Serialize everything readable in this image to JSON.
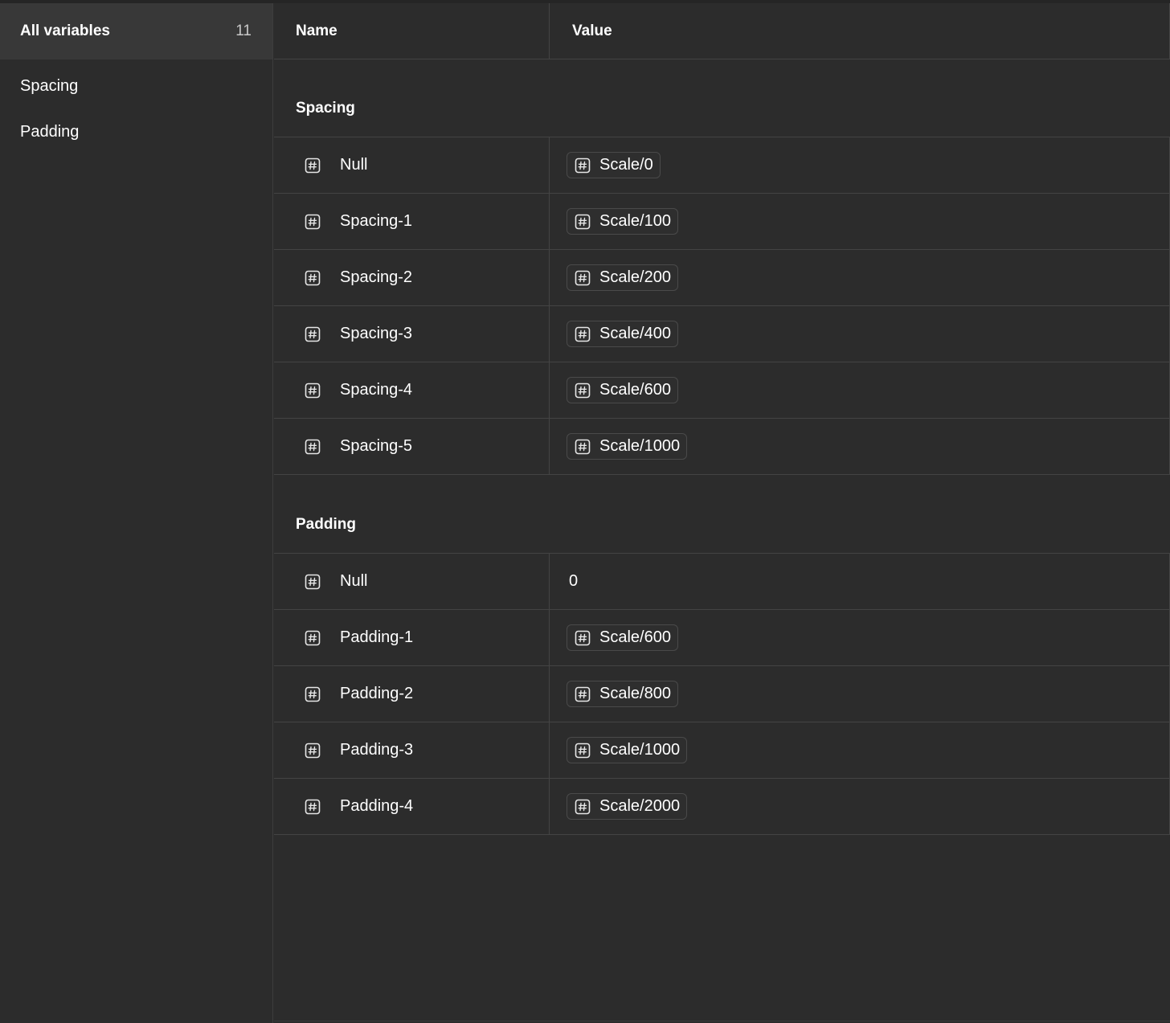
{
  "sidebar": {
    "all_label": "All variables",
    "all_count": "11",
    "groups": [
      "Spacing",
      "Padding"
    ]
  },
  "table": {
    "headers": {
      "name": "Name",
      "value": "Value"
    },
    "groups": [
      {
        "title": "Spacing",
        "rows": [
          {
            "name": "Null",
            "value": "Scale/0",
            "alias": true
          },
          {
            "name": "Spacing-1",
            "value": "Scale/100",
            "alias": true
          },
          {
            "name": "Spacing-2",
            "value": "Scale/200",
            "alias": true
          },
          {
            "name": "Spacing-3",
            "value": "Scale/400",
            "alias": true
          },
          {
            "name": "Spacing-4",
            "value": "Scale/600",
            "alias": true
          },
          {
            "name": "Spacing-5",
            "value": "Scale/1000",
            "alias": true
          }
        ]
      },
      {
        "title": "Padding",
        "rows": [
          {
            "name": "Null",
            "value": "0",
            "alias": false
          },
          {
            "name": "Padding-1",
            "value": "Scale/600",
            "alias": true
          },
          {
            "name": "Padding-2",
            "value": "Scale/800",
            "alias": true
          },
          {
            "name": "Padding-3",
            "value": "Scale/1000",
            "alias": true
          },
          {
            "name": "Padding-4",
            "value": "Scale/2000",
            "alias": true
          }
        ]
      }
    ]
  },
  "icons": {
    "variable_type": "number-hash-icon"
  },
  "colors": {
    "background": "#2c2c2c",
    "selected": "#383838",
    "border": "#444444"
  }
}
